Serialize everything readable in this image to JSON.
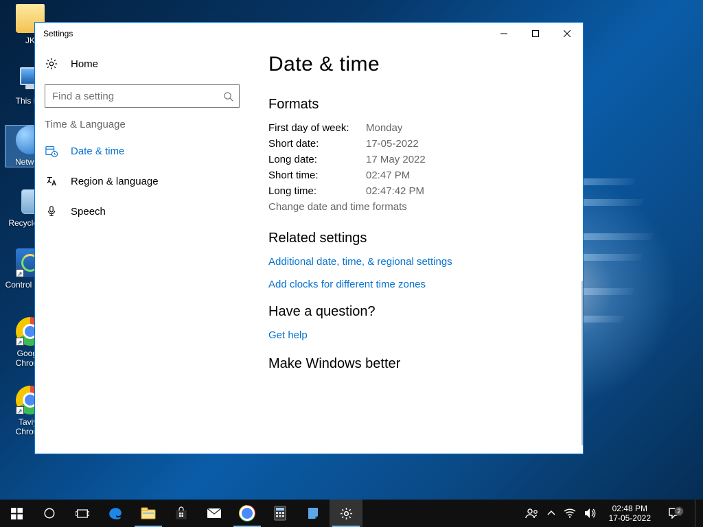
{
  "desktop_icons": {
    "jk": "JK",
    "this_pc": "This PC",
    "network": "Network",
    "recycle": "Recycle Bin",
    "control_panel": "Control Panel",
    "google_chrome": "Google Chrome",
    "taviya_chrome": "Taviya Chrome"
  },
  "window": {
    "title": "Settings",
    "home": "Home",
    "search_placeholder": "Find a setting",
    "category": "Time & Language",
    "nav": {
      "date_time": "Date & time",
      "region": "Region & language",
      "speech": "Speech"
    }
  },
  "content": {
    "heading": "Date & time",
    "formats_heading": "Formats",
    "rows": {
      "first_day_k": "First day of week:",
      "first_day_v": "Monday",
      "short_date_k": "Short date:",
      "short_date_v": "17-05-2022",
      "long_date_k": "Long date:",
      "long_date_v": "17 May 2022",
      "short_time_k": "Short time:",
      "short_time_v": "02:47 PM",
      "long_time_k": "Long time:",
      "long_time_v": "02:47:42 PM"
    },
    "change_formats": "Change date and time formats",
    "related_heading": "Related settings",
    "link_additional": "Additional date, time, & regional settings",
    "link_clocks": "Add clocks for different time zones",
    "question_heading": "Have a question?",
    "link_help": "Get help",
    "better_heading": "Make Windows better"
  },
  "taskbar": {
    "time": "02:48 PM",
    "date": "17-05-2022",
    "action_count": "2"
  }
}
